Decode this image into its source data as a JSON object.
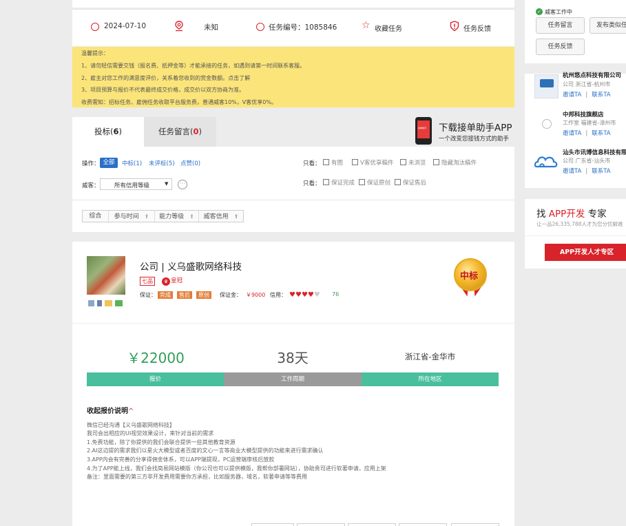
{
  "info_bar": {
    "date": "2024-07-10",
    "location": "未知",
    "task_no": "任务编号：1085846",
    "favorite": "收藏任务",
    "feedback": "任务反馈"
  },
  "notice": {
    "lines": [
      "温馨提示：",
      "1、请勿轻信需要交钱（报名费、抵押金等）才能承接的任务，如遇到请第一时间联系客服。",
      "2、雇主对您工作的满意度评价，关系着您收到的赏金数额。点击了解",
      "3、项目预算与报价不代表最终成交价格，成交价以双方协商为准。",
      "收费需知：招标任务、雇佣任务收取平台服务费，普通威客10%，V客优享0%。"
    ]
  },
  "tabs": [
    {
      "label": "投标(",
      "count": "6",
      "suffix": ")"
    },
    {
      "label": "任务留言(",
      "count": "0",
      "suffix": ")"
    }
  ],
  "app_promo": {
    "title": "下载接单助手APP",
    "subtitle": "一个改变您接钱方式的助手",
    "phone_text": "接单助手"
  },
  "filters": {
    "operation_label": "操作：",
    "ops": [
      "全部",
      "中标(1)",
      "未评标(5)",
      "点赞(0)"
    ],
    "see_only_label": "只看：",
    "see_only_row1": [
      "有图",
      "V客优享稿件",
      "未浏览",
      "隐藏淘汰稿件"
    ],
    "see_only_row2": [
      "保证完成",
      "保证原创",
      "保证售后"
    ],
    "witkey_label": "威客：",
    "credit_select": "所有信用等级",
    "sort_buttons": [
      "综合",
      "参与时间",
      "能力等级",
      "威客信用"
    ]
  },
  "bid": {
    "company_name": "公司 | 义乌盛歌网络科技",
    "level": "七品",
    "crown": "皇冠",
    "guarantee_label": "保证：",
    "guarantee_tags": [
      "完成",
      "售后",
      "原创"
    ],
    "deposit_label": "保证金：",
    "deposit_value": "￥9000",
    "credit_label": "信用：",
    "credit_score": "76",
    "win_badge": "中标",
    "price": "￥22000",
    "period": "38天",
    "region": "浙江省-金华市",
    "price_label": "报价",
    "period_label": "工作周期",
    "region_label": "所在地区",
    "collapse_label": "收起报价说明",
    "description": [
      "微信已经沟通【义乌盛歌网络科技】",
      "我司会出相应的UI视觉效果设计，来针对当前的需求",
      "1.免费功能，除了你提供的我们会联合提供一些其他教育资源",
      "2.AI这边提的需求我们以星火大模型或者百度的文心一言等商业大模型提供的功能来进行需求确认",
      "3.APP内会有完善的分享得佣金体系，可以APP端提现，PC运营端审核后放款",
      "4.为了APP能上线，我们会找简易网站模版（你公司也可以提供模版，我帮你部署网站），协助贵司进行软著申请，应用上架",
      "备注：里面需要的第三方非开发费用需要你方承担，比如服务器，域名，软著申请等等费用"
    ]
  },
  "right": {
    "witkey_working": "威客工作中",
    "buttons": [
      "任务留言",
      "发布类似任",
      "任务反馈"
    ],
    "companies": [
      {
        "name": "杭州悠点科技有限公司",
        "loc": "公司 浙江省-杭州市",
        "invite": "邀请TA",
        "contact": "联系TA"
      },
      {
        "name": "中邦科技旗舰店",
        "loc": "工作室 福建省-漳州市",
        "invite": "邀请TA",
        "contact": "联系TA"
      },
      {
        "name": "汕头市讯博信息科技有限",
        "loc": "公司 广东省-汕头市",
        "invite": "邀请TA",
        "contact": "联系TA"
      }
    ],
    "expert_prefix": "找",
    "expert_highlight": "APP开发",
    "expert_suffix": "专家",
    "expert_sub": "让一品26,335,788人才为您分忧解难",
    "expert_button": "APP开发人才专区"
  },
  "colors": {
    "accent_green": "#3fb89a",
    "accent_red": "#d8232a",
    "notice_bg": "#fbe57a",
    "link_blue": "#2a6fc9"
  }
}
